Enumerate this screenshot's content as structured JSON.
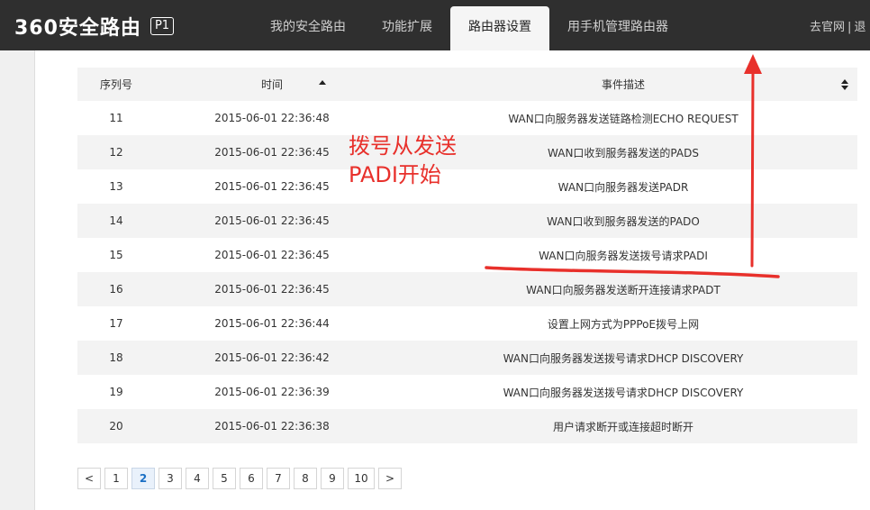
{
  "header": {
    "brand": "360安全路由",
    "badge": "P1",
    "tabs": [
      {
        "label": "我的安全路由"
      },
      {
        "label": "功能扩展"
      },
      {
        "label": "路由器设置",
        "active": true
      },
      {
        "label": "用手机管理路由器"
      }
    ],
    "right_link": "去官网",
    "right_more": "退"
  },
  "table": {
    "headers": [
      "序列号",
      "时间",
      "事件描述"
    ],
    "rows": [
      {
        "index": "11",
        "time": "2015-06-01 22:36:48",
        "desc": "WAN口向服务器发送链路检测ECHO REQUEST"
      },
      {
        "index": "12",
        "time": "2015-06-01 22:36:45",
        "desc": "WAN口收到服务器发送的PADS"
      },
      {
        "index": "13",
        "time": "2015-06-01 22:36:45",
        "desc": "WAN口向服务器发送PADR"
      },
      {
        "index": "14",
        "time": "2015-06-01 22:36:45",
        "desc": "WAN口收到服务器发送的PADO"
      },
      {
        "index": "15",
        "time": "2015-06-01 22:36:45",
        "desc": "WAN口向服务器发送拨号请求PADI"
      },
      {
        "index": "16",
        "time": "2015-06-01 22:36:45",
        "desc": "WAN口向服务器发送断开连接请求PADT"
      },
      {
        "index": "17",
        "time": "2015-06-01 22:36:44",
        "desc": "设置上网方式为PPPoE拨号上网"
      },
      {
        "index": "18",
        "time": "2015-06-01 22:36:42",
        "desc": "WAN口向服务器发送拨号请求DHCP DISCOVERY"
      },
      {
        "index": "19",
        "time": "2015-06-01 22:36:39",
        "desc": "WAN口向服务器发送拨号请求DHCP DISCOVERY"
      },
      {
        "index": "20",
        "time": "2015-06-01 22:36:38",
        "desc": "用户请求断开或连接超时断开"
      }
    ]
  },
  "pagination": {
    "prev": "<",
    "pages": [
      "1",
      "2",
      "3",
      "4",
      "5",
      "6",
      "7",
      "8",
      "9",
      "10"
    ],
    "current": "2",
    "next": ">"
  },
  "annotation": {
    "line1": "拨号从发送",
    "line2": "PADI开始",
    "color": "#e8302b"
  }
}
